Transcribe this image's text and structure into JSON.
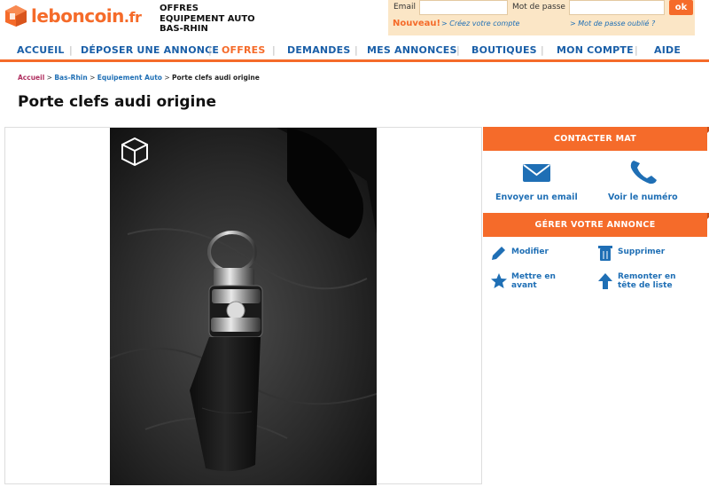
{
  "brand": {
    "logo_name": "leboncoin",
    "logo_tld": ".fr",
    "accent": "#f56b2a",
    "link": "#1f6fb5"
  },
  "header_context": [
    "OFFRES",
    "EQUIPEMENT AUTO",
    "BAS-RHIN"
  ],
  "login": {
    "email_label": "Email",
    "password_label": "Mot de passe",
    "ok_label": "ok",
    "new_label": "Nouveau!",
    "create_link": "> Créez votre compte",
    "forgot_link": "> Mot de passe oublié ?"
  },
  "nav": [
    "ACCUEIL",
    "DÉPOSER UNE ANNONCE",
    "OFFRES",
    "DEMANDES",
    "MES ANNONCES",
    "BOUTIQUES",
    "MON COMPTE",
    "AIDE"
  ],
  "nav_active": "OFFRES",
  "breadcrumb": {
    "home": "Accueil",
    "sep": " > ",
    "region": "Bas-Rhin",
    "category": "Equipement Auto",
    "current": "Porte clefs audi origine"
  },
  "title": "Porte clefs audi origine",
  "photo": {
    "subject": "keychain-photo",
    "watermark_icon": "lbc-cube-icon"
  },
  "sidebar": {
    "contact_header": "CONTACTER MAT",
    "email_action": "Envoyer un email",
    "phone_action": "Voir le numéro",
    "manage_header": "GÉRER VOTRE ANNONCE",
    "modify": "Modifier",
    "delete": "Supprimer",
    "highlight": [
      "Mettre en",
      "avant"
    ],
    "bump": [
      "Remonter en",
      "tête de liste"
    ]
  }
}
